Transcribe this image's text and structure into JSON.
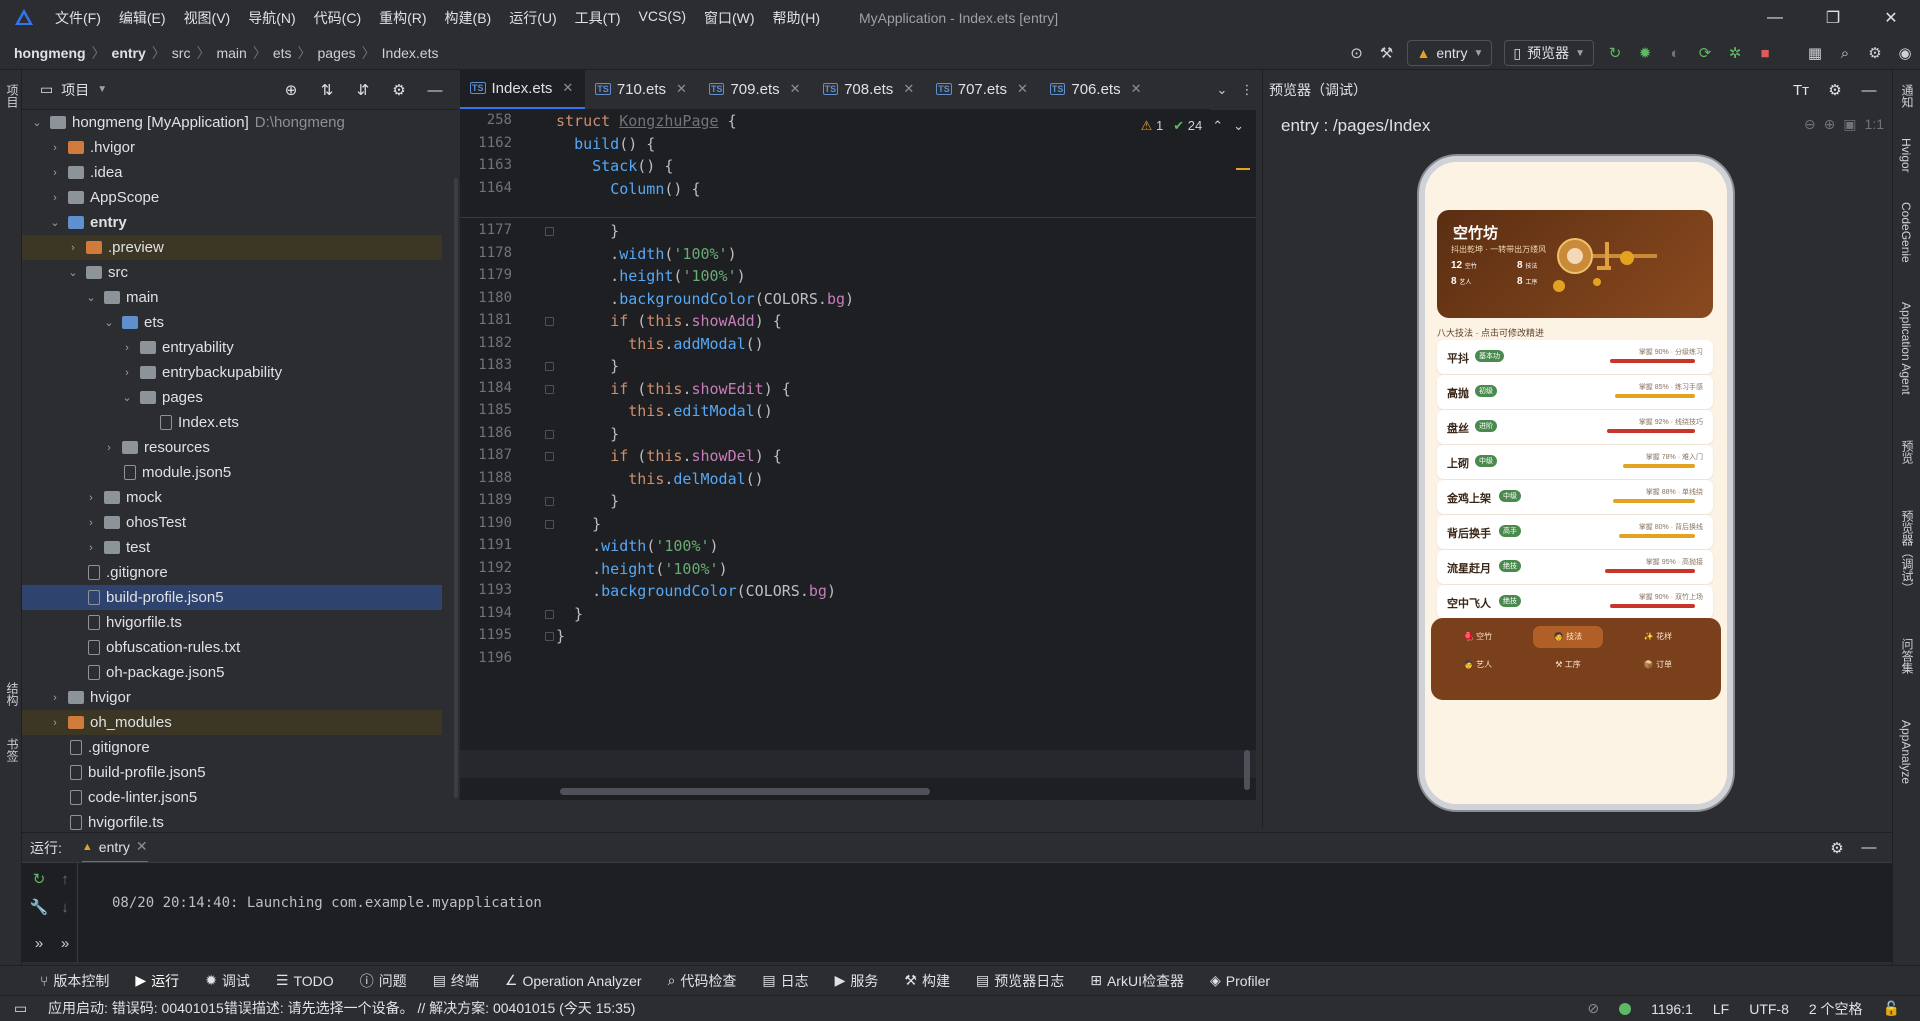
{
  "window": {
    "menu": [
      "文件(F)",
      "编辑(E)",
      "视图(V)",
      "导航(N)",
      "代码(C)",
      "重构(R)",
      "构建(B)",
      "运行(U)",
      "工具(T)",
      "VCS(S)",
      "窗口(W)",
      "帮助(H)"
    ],
    "title": "MyApplication - Index.ets [entry]"
  },
  "breadcrumb": [
    "hongmeng",
    "entry",
    "src",
    "main",
    "ets",
    "pages",
    "Index.ets"
  ],
  "toolbar": {
    "run_config": "entry",
    "device": "预览器"
  },
  "project_panel": {
    "title": "项目",
    "tree": [
      {
        "label": "hongmeng [MyApplication]",
        "extra": "D:\\hongmeng",
        "depth": 0,
        "arrow": "open",
        "icon": "folder"
      },
      {
        "label": ".hvigor",
        "depth": 1,
        "arrow": "closed",
        "icon": "folder-o"
      },
      {
        "label": ".idea",
        "depth": 1,
        "arrow": "closed",
        "icon": "folder"
      },
      {
        "label": "AppScope",
        "depth": 1,
        "arrow": "closed",
        "icon": "folder"
      },
      {
        "label": "entry",
        "depth": 1,
        "arrow": "open",
        "icon": "folder-b",
        "bold": true
      },
      {
        "label": ".preview",
        "depth": 2,
        "arrow": "closed",
        "icon": "folder-o",
        "hl": true
      },
      {
        "label": "src",
        "depth": 2,
        "arrow": "open",
        "icon": "folder"
      },
      {
        "label": "main",
        "depth": 3,
        "arrow": "open",
        "icon": "folder"
      },
      {
        "label": "ets",
        "depth": 4,
        "arrow": "open",
        "icon": "folder-b"
      },
      {
        "label": "entryability",
        "depth": 5,
        "arrow": "closed",
        "icon": "folder"
      },
      {
        "label": "entrybackupability",
        "depth": 5,
        "arrow": "closed",
        "icon": "folder"
      },
      {
        "label": "pages",
        "depth": 5,
        "arrow": "open",
        "icon": "folder"
      },
      {
        "label": "Index.ets",
        "depth": 6,
        "arrow": "",
        "icon": "file"
      },
      {
        "label": "resources",
        "depth": 4,
        "arrow": "closed",
        "icon": "folder"
      },
      {
        "label": "module.json5",
        "depth": 4,
        "arrow": "",
        "icon": "file"
      },
      {
        "label": "mock",
        "depth": 3,
        "arrow": "closed",
        "icon": "folder"
      },
      {
        "label": "ohosTest",
        "depth": 3,
        "arrow": "closed",
        "icon": "folder"
      },
      {
        "label": "test",
        "depth": 3,
        "arrow": "closed",
        "icon": "folder"
      },
      {
        "label": ".gitignore",
        "depth": 2,
        "arrow": "",
        "icon": "file"
      },
      {
        "label": "build-profile.json5",
        "depth": 2,
        "arrow": "",
        "icon": "file",
        "sel": true
      },
      {
        "label": "hvigorfile.ts",
        "depth": 2,
        "arrow": "",
        "icon": "file"
      },
      {
        "label": "obfuscation-rules.txt",
        "depth": 2,
        "arrow": "",
        "icon": "file"
      },
      {
        "label": "oh-package.json5",
        "depth": 2,
        "arrow": "",
        "icon": "file"
      },
      {
        "label": "hvigor",
        "depth": 1,
        "arrow": "closed",
        "icon": "folder"
      },
      {
        "label": "oh_modules",
        "depth": 1,
        "arrow": "closed",
        "icon": "folder-o",
        "hl": true
      },
      {
        "label": ".gitignore",
        "depth": 1,
        "arrow": "",
        "icon": "file"
      },
      {
        "label": "build-profile.json5",
        "depth": 1,
        "arrow": "",
        "icon": "file"
      },
      {
        "label": "code-linter.json5",
        "depth": 1,
        "arrow": "",
        "icon": "file"
      },
      {
        "label": "hvigorfile.ts",
        "depth": 1,
        "arrow": "",
        "icon": "file"
      }
    ]
  },
  "tabs": [
    "Index.ets",
    "710.ets",
    "709.ets",
    "708.ets",
    "707.ets",
    "706.ets"
  ],
  "editor": {
    "warnings": "1",
    "weak_warnings": "24",
    "sticky": [
      {
        "n": "258",
        "code": "struct KongzhuPage {"
      },
      {
        "n": "1162",
        "code": "  build() {"
      },
      {
        "n": "1163",
        "code": "    Stack() {"
      },
      {
        "n": "1164",
        "code": "      Column() {"
      }
    ],
    "lines": [
      {
        "n": "1177",
        "code": "      }"
      },
      {
        "n": "1178",
        "code": "      .width('100%')"
      },
      {
        "n": "1179",
        "code": "      .height('100%')"
      },
      {
        "n": "1180",
        "code": "      .backgroundColor(COLORS.bg)"
      },
      {
        "n": "1181",
        "code": "      if (this.showAdd) {"
      },
      {
        "n": "1182",
        "code": "        this.addModal()"
      },
      {
        "n": "1183",
        "code": "      }"
      },
      {
        "n": "1184",
        "code": "      if (this.showEdit) {"
      },
      {
        "n": "1185",
        "code": "        this.editModal()"
      },
      {
        "n": "1186",
        "code": "      }"
      },
      {
        "n": "1187",
        "code": "      if (this.showDel) {"
      },
      {
        "n": "1188",
        "code": "        this.delModal()"
      },
      {
        "n": "1189",
        "code": "      }"
      },
      {
        "n": "1190",
        "code": "    }"
      },
      {
        "n": "1191",
        "code": "    .width('100%')"
      },
      {
        "n": "1192",
        "code": "    .height('100%')"
      },
      {
        "n": "1193",
        "code": "    .backgroundColor(COLORS.bg)"
      },
      {
        "n": "1194",
        "code": "  }"
      },
      {
        "n": "1195",
        "code": "}"
      },
      {
        "n": "1196",
        "code": ""
      }
    ]
  },
  "preview": {
    "title": "预览器（调试）",
    "path": "entry : /pages/Index",
    "app": {
      "hero_title": "空竹坊",
      "hero_sub": "抖出乾坤 · 一转带出万缕风",
      "stats": [
        "12",
        "空竹",
        "8",
        "技法",
        "8",
        "艺人",
        "8",
        "工序"
      ],
      "section": "八大技法 · 点击可修改精进",
      "skills": [
        {
          "name": "平抖",
          "badge": "基本功",
          "meta": "掌握 90% · 分级练习",
          "level": 0.85,
          "color": "#c8352b"
        },
        {
          "name": "高抛",
          "badge": "初级",
          "meta": "掌握 85% · 练习手感",
          "level": 0.8,
          "color": "#e3a321"
        },
        {
          "name": "盘丝",
          "badge": "进阶",
          "meta": "掌握 92% · 线绕技巧",
          "level": 0.88,
          "color": "#c8352b"
        },
        {
          "name": "上砌",
          "badge": "中级",
          "meta": "掌握 78% · 难入门",
          "level": 0.72,
          "color": "#e3a321"
        },
        {
          "name": "金鸡上架",
          "badge": "中级",
          "meta": "掌握 88% · 单线绕",
          "level": 0.82,
          "color": "#e3a321"
        },
        {
          "name": "背后换手",
          "badge": "高手",
          "meta": "掌握 80% · 背后换线",
          "level": 0.76,
          "color": "#e3a321"
        },
        {
          "name": "流星赶月",
          "badge": "绝技",
          "meta": "掌握 95% · 高抛接",
          "level": 0.9,
          "color": "#c8352b"
        },
        {
          "name": "空中飞人",
          "badge": "绝技",
          "meta": "掌握 90% · 双竹上场",
          "level": 0.85,
          "color": "#c8352b"
        }
      ],
      "nav": [
        "空竹",
        "技法",
        "花样",
        "艺人",
        "工序",
        "订单"
      ],
      "nav_active": "技法"
    }
  },
  "run": {
    "label": "运行:",
    "config": "entry",
    "output": "08/20 20:14:40: Launching com.example.myapplication"
  },
  "tool_windows": [
    "版本控制",
    "运行",
    "调试",
    "TODO",
    "问题",
    "终端",
    "Operation Analyzer",
    "代码检查",
    "日志",
    "服务",
    "构建",
    "预览器日志",
    "ArkUI检查器",
    "Profiler"
  ],
  "left_strip": [
    "项目",
    "结构",
    "书签"
  ],
  "right_strip": [
    "通知",
    "Hvigor",
    "CodeGenie",
    "Application Agent",
    "预览",
    "预览器（调试）",
    "问答集",
    "AppAnalyze"
  ],
  "status": {
    "message": "应用启动: 错误码: 00401015错误描述: 请先选择一个设备。 // 解决方案: 00401015 (今天 15:35)",
    "position": "1196:1",
    "line_sep": "LF",
    "encoding": "UTF-8",
    "indent": "2 个空格"
  }
}
